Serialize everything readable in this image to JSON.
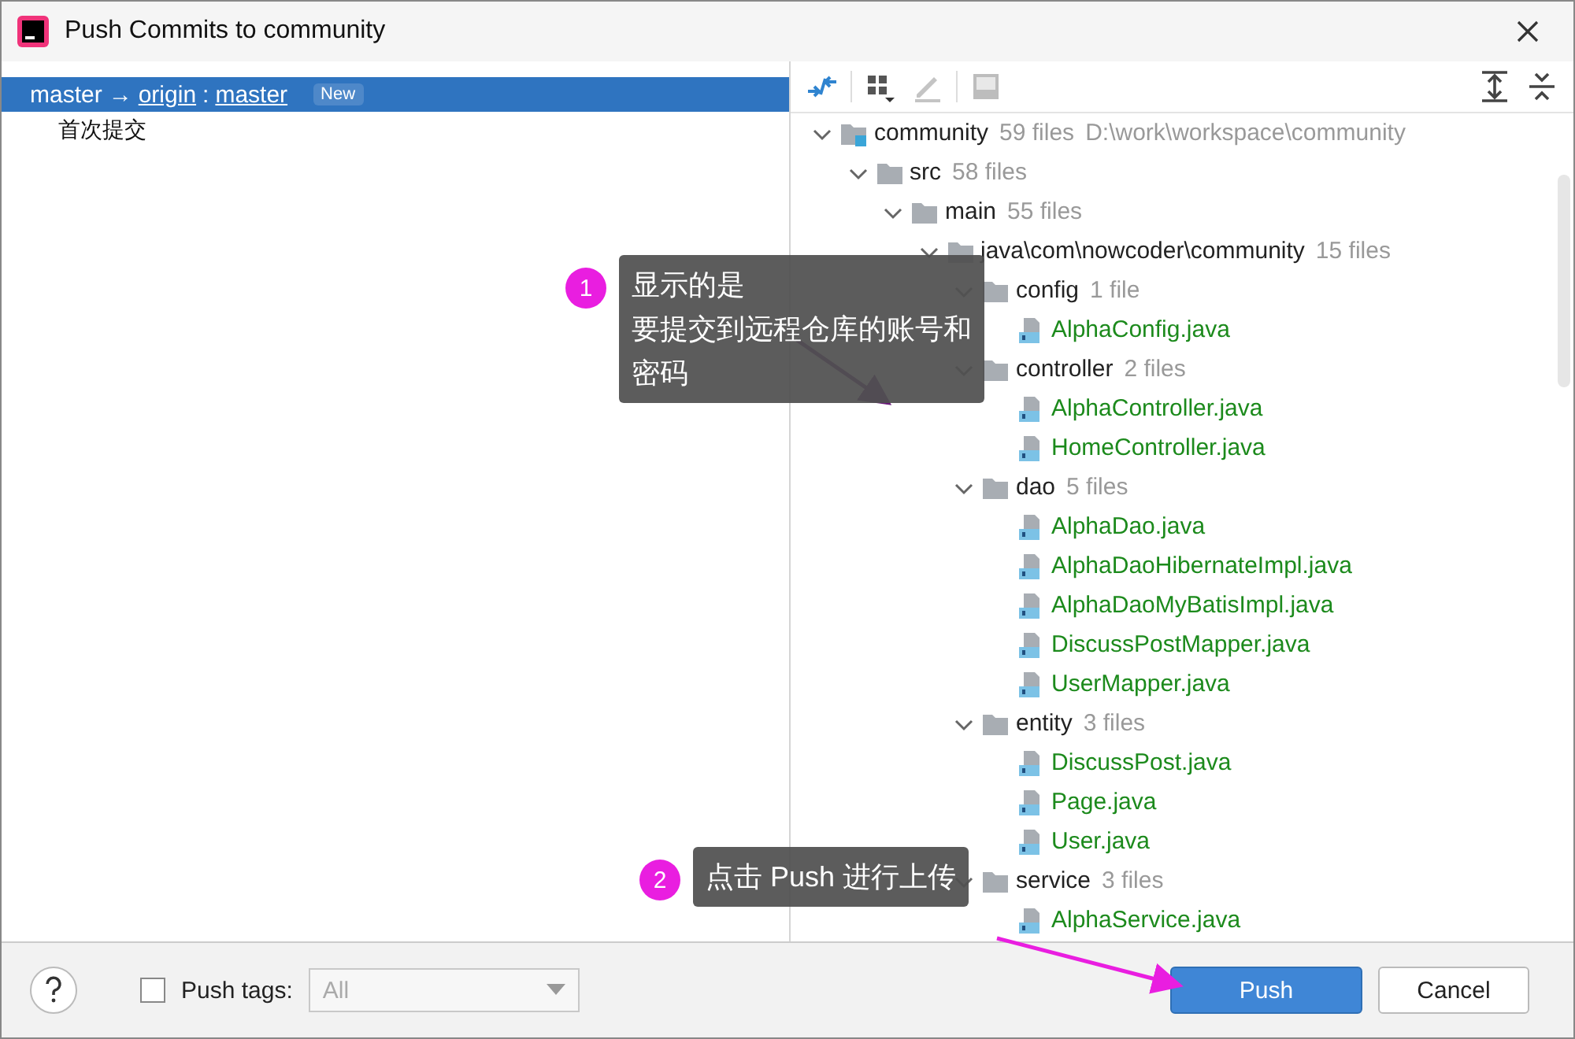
{
  "window": {
    "title": "Push Commits to community"
  },
  "push_list": {
    "branch": {
      "local": "master",
      "arrow": "→",
      "remote": "origin",
      "separator": ":",
      "remote_branch": "master",
      "badge": "New",
      "selected": true
    },
    "commits": [
      {
        "message": "首次提交",
        "selected": false
      }
    ]
  },
  "tree": [
    {
      "kind": "module",
      "name": "community",
      "count": "59 files",
      "path": "D:\\work\\workspace\\community",
      "expanded": true,
      "children": [
        {
          "kind": "folder",
          "name": "src",
          "count": "58 files",
          "expanded": true,
          "children": [
            {
              "kind": "folder",
              "name": "main",
              "count": "55 files",
              "expanded": true,
              "children": [
                {
                  "kind": "folder",
                  "name": "java\\com\\nowcoder\\community",
                  "count": "15 files",
                  "expanded": true,
                  "children": [
                    {
                      "kind": "folder",
                      "name": "config",
                      "count": "1 file",
                      "expanded": true,
                      "children": [
                        {
                          "kind": "file",
                          "name": "AlphaConfig.java"
                        }
                      ]
                    },
                    {
                      "kind": "folder",
                      "name": "controller",
                      "count": "2 files",
                      "expanded": true,
                      "children": [
                        {
                          "kind": "file",
                          "name": "AlphaController.java"
                        },
                        {
                          "kind": "file",
                          "name": "HomeController.java"
                        }
                      ]
                    },
                    {
                      "kind": "folder",
                      "name": "dao",
                      "count": "5 files",
                      "expanded": true,
                      "children": [
                        {
                          "kind": "file",
                          "name": "AlphaDao.java"
                        },
                        {
                          "kind": "file",
                          "name": "AlphaDaoHibernateImpl.java"
                        },
                        {
                          "kind": "file",
                          "name": "AlphaDaoMyBatisImpl.java"
                        },
                        {
                          "kind": "file",
                          "name": "DiscussPostMapper.java"
                        },
                        {
                          "kind": "file",
                          "name": "UserMapper.java"
                        }
                      ]
                    },
                    {
                      "kind": "folder",
                      "name": "entity",
                      "count": "3 files",
                      "expanded": true,
                      "children": [
                        {
                          "kind": "file",
                          "name": "DiscussPost.java"
                        },
                        {
                          "kind": "file",
                          "name": "Page.java"
                        },
                        {
                          "kind": "file",
                          "name": "User.java"
                        }
                      ]
                    },
                    {
                      "kind": "folder",
                      "name": "service",
                      "count": "3 files",
                      "expanded": true,
                      "children": [
                        {
                          "kind": "file",
                          "name": "AlphaService.java"
                        }
                      ]
                    }
                  ]
                }
              ]
            }
          ]
        }
      ]
    }
  ],
  "footer": {
    "push_tags": {
      "label": "Push tags:",
      "checked": false
    },
    "tags_select": {
      "value": "All",
      "disabled": true
    },
    "buttons": [
      {
        "label": "Push",
        "kind": "primary"
      },
      {
        "label": "Cancel",
        "kind": "secondary"
      }
    ]
  },
  "annotations": [
    {
      "number": "1",
      "lines": [
        "显示的是",
        "要提交到远程仓库的账号和",
        "密码"
      ]
    },
    {
      "number": "2",
      "lines": [
        "点击 Push 进行上传"
      ]
    }
  ]
}
